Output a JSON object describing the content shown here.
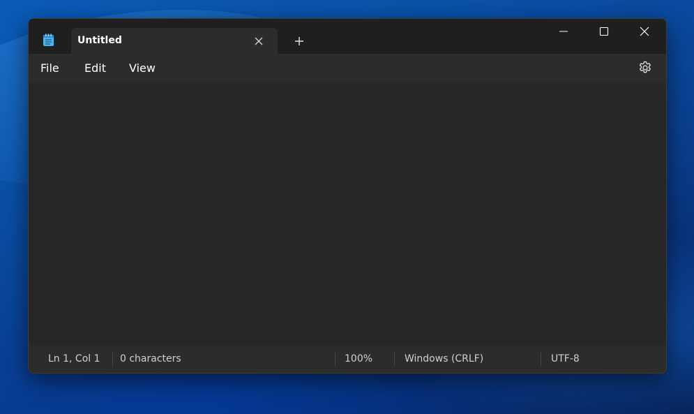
{
  "window": {
    "app_icon": "notepad-icon",
    "tab_title": "Untitled",
    "tab_close_icon": "close-icon",
    "new_tab_icon": "plus-icon",
    "minimize_icon": "minimize-icon",
    "maximize_icon": "maximize-icon",
    "close_icon": "close-icon"
  },
  "menu": {
    "file": "File",
    "edit": "Edit",
    "view": "View",
    "settings_icon": "gear-icon"
  },
  "editor": {
    "content": ""
  },
  "status": {
    "position": "Ln 1, Col 1",
    "characters": "0 characters",
    "zoom": "100%",
    "line_ending": "Windows (CRLF)",
    "encoding": "UTF-8"
  },
  "colors": {
    "titlebar_bg": "#1f1f1f",
    "tab_bg": "#2c2c2c",
    "editor_bg": "#272727",
    "text": "#ffffff",
    "icon_accent": "#4fb3e8"
  }
}
